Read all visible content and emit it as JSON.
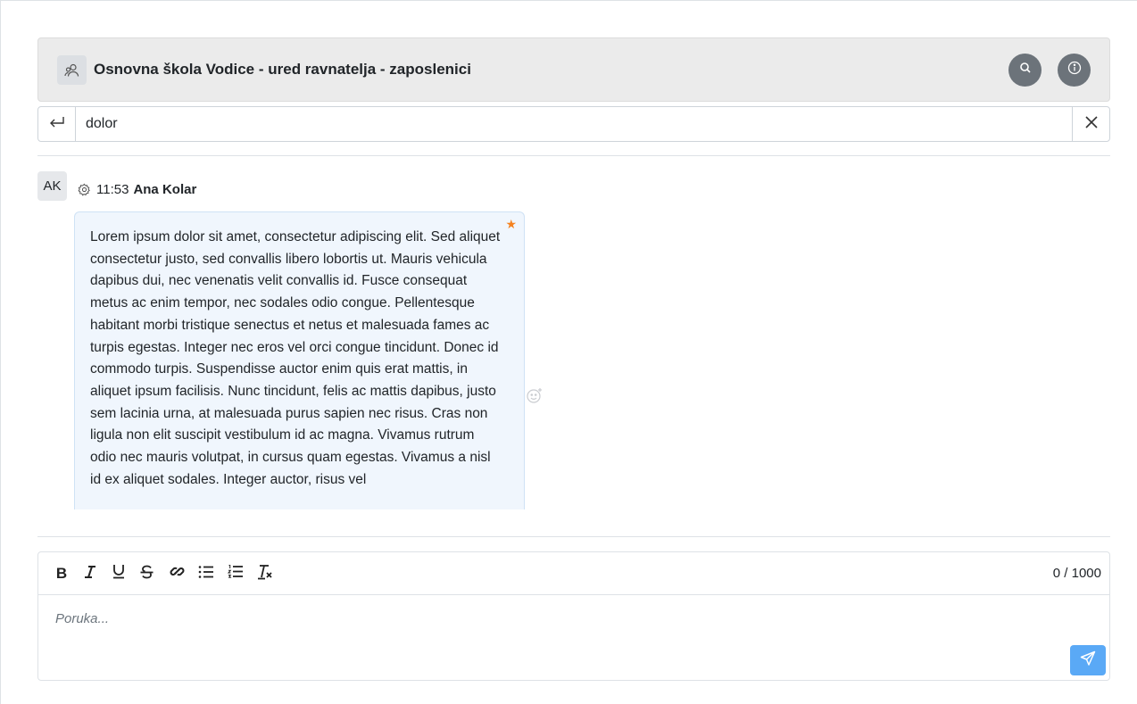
{
  "header": {
    "title": "Osnovna škola Vodice - ured ravnatelja - zaposlenici",
    "group_icon": "users-icon",
    "search_button_icon": "search-icon",
    "info_button_icon": "info-icon"
  },
  "search": {
    "value": "dolor",
    "back_icon": "return-arrow-icon",
    "clear_icon": "close-icon"
  },
  "message": {
    "avatar_initials": "AK",
    "settings_icon": "gear-icon",
    "time": "11:53",
    "author": "Ana Kolar",
    "starred": true,
    "star_color": "#f5821f",
    "text": "Lorem ipsum dolor sit amet, consectetur adipiscing elit. Sed aliquet consectetur justo, sed convallis libero lobortis ut. Mauris vehicula dapibus dui, nec venenatis velit convallis id. Fusce consequat metus ac enim tempor, nec sodales odio congue. Pellentesque habitant morbi tristique senectus et netus et malesuada fames ac turpis egestas. Integer nec eros vel orci congue tincidunt. Donec id commodo turpis. Suspendisse auctor enim quis erat mattis, in aliquet ipsum facilisis. Nunc tincidunt, felis ac mattis dapibus, justo sem lacinia urna, at malesuada purus sapien nec risus. Cras non ligula non elit suscipit vestibulum id ac magna. Vivamus rutrum odio nec mauris volutpat, in cursus quam egestas. Vivamus a nisl id ex aliquet sodales. Integer auctor, risus vel",
    "react_icon": "emoji-add-icon"
  },
  "editor": {
    "toolbar": [
      {
        "name": "bold",
        "icon": "bold-icon"
      },
      {
        "name": "italic",
        "icon": "italic-icon"
      },
      {
        "name": "underline",
        "icon": "underline-icon"
      },
      {
        "name": "strikethrough",
        "icon": "strikethrough-icon"
      },
      {
        "name": "link",
        "icon": "link-icon"
      },
      {
        "name": "bullet-list",
        "icon": "bullet-list-icon"
      },
      {
        "name": "ordered-list",
        "icon": "ordered-list-icon"
      },
      {
        "name": "clear-format",
        "icon": "clear-format-icon"
      }
    ],
    "counter": "0 / 1000",
    "placeholder": "Poruka...",
    "send_icon": "send-icon",
    "send_color": "#5aa9f6"
  }
}
